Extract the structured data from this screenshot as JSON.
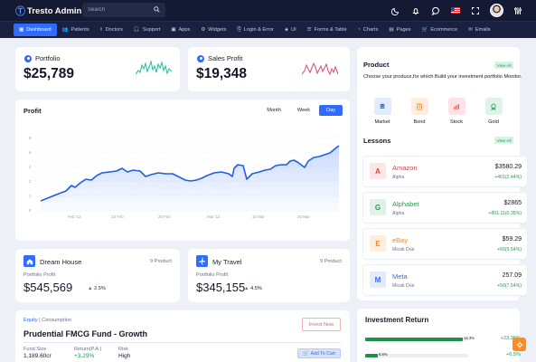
{
  "app": {
    "brand": "Tresto Admin"
  },
  "search": {
    "placeholder": "Search"
  },
  "nav": [
    {
      "label": "Dashboard",
      "icon": "grid-icon",
      "active": true
    },
    {
      "label": "Patients",
      "icon": "users-icon"
    },
    {
      "label": "Doctors",
      "icon": "stethoscope-icon"
    },
    {
      "label": "Support",
      "icon": "headset-icon"
    },
    {
      "label": "Apps",
      "icon": "apps-icon"
    },
    {
      "label": "Widgets",
      "icon": "widgets-icon"
    },
    {
      "label": "Login & Error",
      "icon": "login-icon"
    },
    {
      "label": "UI",
      "icon": "ui-icon"
    },
    {
      "label": "Forms & Table",
      "icon": "forms-icon"
    },
    {
      "label": "Charts",
      "icon": "chart-icon"
    },
    {
      "label": "Pages",
      "icon": "pages-icon"
    },
    {
      "label": "Ecommerce",
      "icon": "cart-icon"
    },
    {
      "label": "Emails",
      "icon": "mail-icon"
    }
  ],
  "portfolio": {
    "label": "Portfolio",
    "value": "$25,789",
    "color": "#2cc39b"
  },
  "sales": {
    "label": "Sales Profit",
    "value": "$19,348",
    "color": "#e0567a"
  },
  "profit": {
    "title": "Profit",
    "toggles": [
      "Month",
      "Week",
      "Day"
    ],
    "active_toggle": "Day",
    "x_labels": [
      "Feb '12",
      "10 Feb",
      "20 Feb",
      "Mar '12",
      "10 Mar",
      "20 Mar"
    ],
    "line_color": "#1f5fe0"
  },
  "dream_house": {
    "title": "Dream House",
    "count": "9 Product",
    "label": "Portfolio Profit",
    "value": "$545,569",
    "delta": "2.5%"
  },
  "my_travel": {
    "title": "My Travel",
    "count": "9 Product",
    "label": "Portfolio Profit",
    "value": "$345,155",
    "delta": "4.5%"
  },
  "fund": {
    "tag1": "Equity",
    "tag2": "Consumption",
    "name": "Prudential FMCG Fund - Growth",
    "invest_label": "Invest Now",
    "cart_label": "Add To Cart",
    "stats": [
      {
        "label": "Fund Size",
        "value": "1,189.60cr"
      },
      {
        "label": "Return(P.A.)",
        "value": "+3.29%"
      },
      {
        "label": "Risk",
        "value": "High"
      }
    ]
  },
  "product": {
    "title": "Product",
    "view_all": "View All",
    "desc": "Choose your produce,for which Build your investment portfolio Monitor.",
    "items": [
      {
        "label": "Market",
        "bg": "#e3ebff",
        "fg": "#2f6bff"
      },
      {
        "label": "Bond",
        "bg": "#ffeedd",
        "fg": "#f08a24"
      },
      {
        "label": "Stock",
        "bg": "#fde3e3",
        "fg": "#e14b4b"
      },
      {
        "label": "Gold",
        "bg": "#dff3e8",
        "fg": "#1f9d55"
      }
    ]
  },
  "lessons": {
    "title": "Lessons",
    "view_all": "View All",
    "items": [
      {
        "letter": "A",
        "name": "Amazon",
        "sub": "Alpha",
        "price": "$3580.29",
        "change": "+401(2.44%)",
        "bg": "#fde6e6",
        "fg": "#d64545",
        "name_color": "#d64545"
      },
      {
        "letter": "G",
        "name": "Alphabet",
        "sub": "Alpha",
        "price": "$2865",
        "change": "+801.11(0.35%)",
        "bg": "#def2e5",
        "fg": "#1f9d55",
        "name_color": "#1f9d55"
      },
      {
        "letter": "E",
        "name": "eBay",
        "sub": "Micak Doe",
        "price": "$59.29",
        "change": "+66(9.54%)",
        "bg": "#ffeedd",
        "fg": "#f08a24",
        "name_color": "#f08a24"
      },
      {
        "letter": "M",
        "name": "Meta",
        "sub": "Micak Doe",
        "price": "257.09",
        "change": "+50(7.54%)",
        "bg": "#e3ebff",
        "fg": "#2f6bff",
        "name_color": "#2f6bff"
      }
    ]
  },
  "investment": {
    "title": "Investment Return",
    "rows": [
      {
        "pct": "14.3%",
        "value": "+23.36%",
        "fill": 0.95
      },
      {
        "pct": "6.8%",
        "value": "+6.5%",
        "fill": 0.12
      }
    ]
  }
}
